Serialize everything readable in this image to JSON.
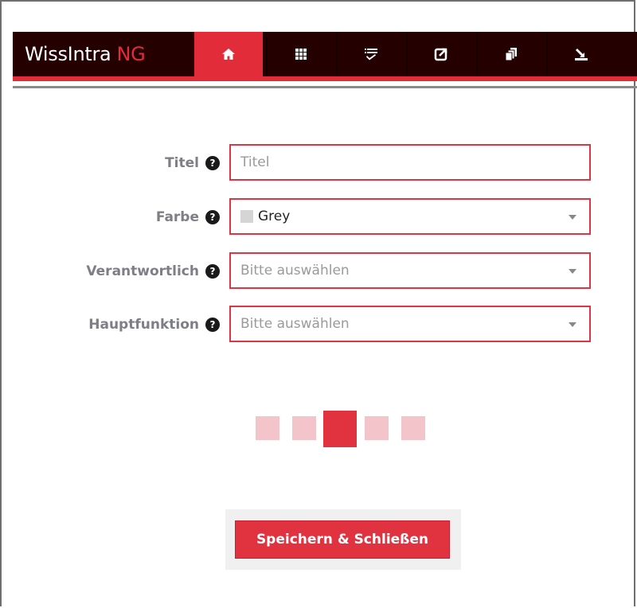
{
  "app": {
    "logo_main": "WissIntra",
    "logo_accent": "NG",
    "accent_color": "#e22c3a",
    "bar_color": "#240000"
  },
  "nav": [
    {
      "icon": "home-icon",
      "active": true
    },
    {
      "icon": "grid-icon",
      "active": false
    },
    {
      "icon": "checklist-icon",
      "active": false
    },
    {
      "icon": "external-link-icon",
      "active": false
    },
    {
      "icon": "documents-icon",
      "active": false
    },
    {
      "icon": "download-icon",
      "active": false
    }
  ],
  "form": {
    "titel": {
      "label": "Titel",
      "placeholder": "Titel",
      "value": ""
    },
    "farbe": {
      "label": "Farbe",
      "value": "Grey",
      "swatch_color": "#d5d5d5"
    },
    "verantwortlich": {
      "label": "Verantwortlich",
      "placeholder": "Bitte auswählen"
    },
    "hauptfunktion": {
      "label": "Hauptfunktion",
      "placeholder": "Bitte auswählen"
    }
  },
  "help_glyph": "?",
  "actions": {
    "save_label": "Speichern & Schließen"
  }
}
